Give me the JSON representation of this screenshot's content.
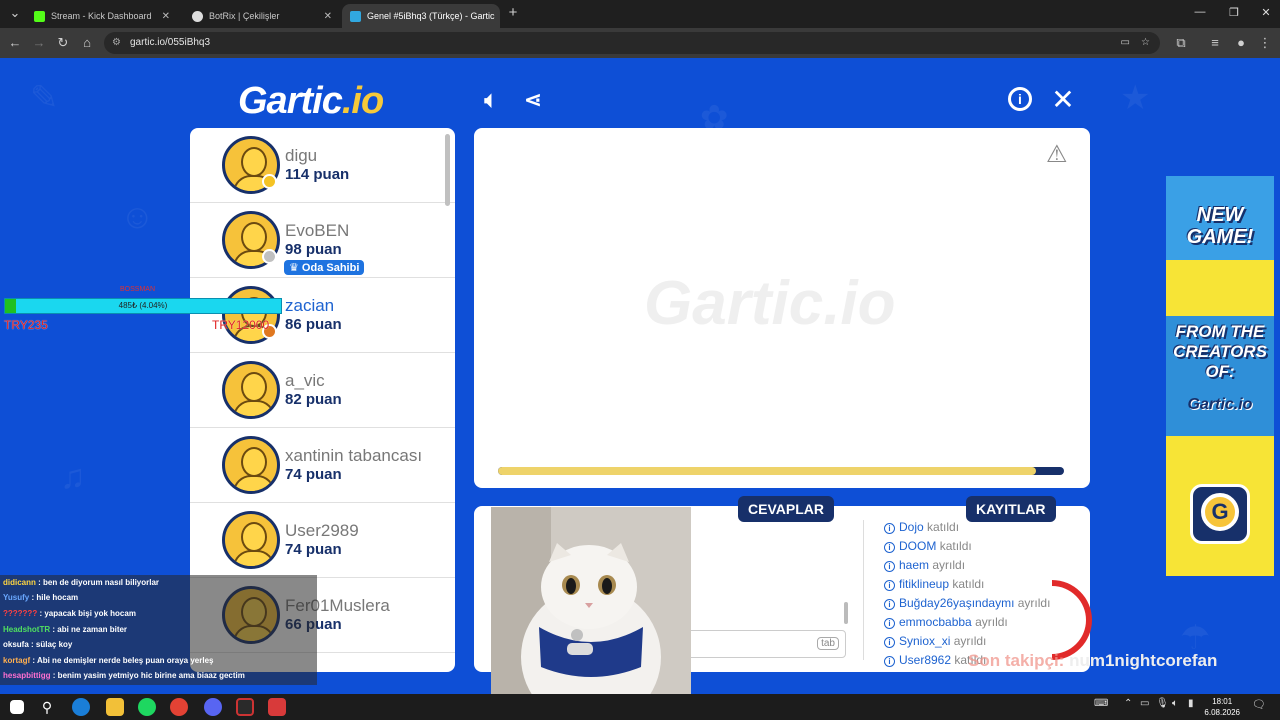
{
  "browser": {
    "tabs": [
      {
        "label": "Stream - Kick Dashboard",
        "favicon_color": "#53fc18"
      },
      {
        "label": "BotRix | Çekilişler",
        "favicon_color": "#dddddd"
      },
      {
        "label": "Genel #5iBhq3 (Türkçe) - Gartic",
        "favicon_color": "#31a8e0"
      }
    ],
    "active_tab": 2,
    "url": "gartic.io/055iBhq3"
  },
  "game": {
    "logo_main": "Gartic",
    "logo_suffix": ".io",
    "players": [
      {
        "name": "digu",
        "points": "114 puan",
        "dot_color": "#f5c324"
      },
      {
        "name": "EvoBEN",
        "points": "98 puan",
        "dot_color": "#c0c0c0",
        "badge": "Oda Sahibi"
      },
      {
        "name": "zacian",
        "points": "86 puan",
        "dot_color": "#e07820"
      },
      {
        "name": "a_vic",
        "points": "82 puan"
      },
      {
        "name": "xantinin tabancası",
        "points": "74 puan"
      },
      {
        "name": "User2989",
        "points": "74 puan"
      },
      {
        "name": "Fer01Muslera",
        "points": "66 puan"
      }
    ],
    "canvas_watermark": "Gartic.io",
    "timer_progress": 0.95,
    "tabs": {
      "answers": "CEVAPLAR",
      "logs": "KAYITLAR"
    },
    "answer_hint": "tab",
    "logs": [
      {
        "user": "Dojo",
        "action": "katıldı"
      },
      {
        "user": "DOOM",
        "action": "katıldı"
      },
      {
        "user": "haem",
        "action": "ayrıldı"
      },
      {
        "user": "fitiklineup",
        "action": "katıldı"
      },
      {
        "user": "Buğday26yaşındaymı",
        "action": "ayrıldı"
      },
      {
        "user": "emmocbabba",
        "action": "ayrıldı"
      },
      {
        "user": "Syniox_xi",
        "action": "ayrıldı"
      },
      {
        "user": "User8962",
        "action": "katıldı"
      }
    ]
  },
  "ad": {
    "line1": "NEW",
    "line2": "GAME!",
    "line3": "FROM THE",
    "line4": "CREATORS",
    "line5": "OF:",
    "brand": "Gartic.io",
    "coin": "G"
  },
  "overlay": {
    "hp_text": "485₺ (4.04%)",
    "hp_fraction": 0.04,
    "hp_name": "BOSSMAN",
    "try_left": "TRY235",
    "try_mid": "TRY12000",
    "chat": [
      {
        "user": "didicann",
        "msg": ": ben de diyorum nasıl biliyorlar",
        "color": "#ffd640"
      },
      {
        "user": "Yusufy",
        "msg": ": hile hocam",
        "color": "#6aa8ff"
      },
      {
        "user": "???????",
        "msg": ": yapacak bişi yok hocam",
        "color": "#ff4040"
      },
      {
        "user": "HeadshotTR",
        "msg": ": abi ne zaman biter",
        "color": "#50e060"
      },
      {
        "user": "oksufa",
        "msg": ": sülaç koy",
        "color": "#ffffff"
      },
      {
        "user": "kortagf",
        "msg": ": Abi ne demişler nerde beleş puan oraya yerleş",
        "color": "#ffb050"
      },
      {
        "user": "hesapbittigg",
        "msg": ": benim yasim yetmiyo hic birine ama biaaz gectim",
        "color": "#ff70d0"
      }
    ],
    "follow_label": "Son takipçi:",
    "follow_name": "num1nightcorefan"
  },
  "taskbar": {
    "time": "18:01",
    "date": "6.08.2026"
  }
}
